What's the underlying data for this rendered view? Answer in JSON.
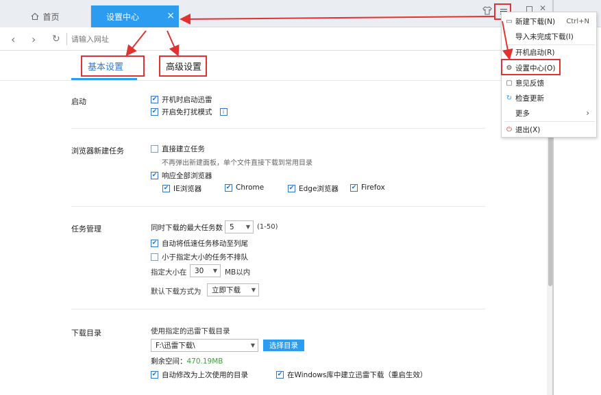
{
  "tabs": {
    "home": "首页",
    "settings": "设置中心",
    "close": "×"
  },
  "address": {
    "placeholder": "请输入网址"
  },
  "subtabs": {
    "basic": "基本设置",
    "advanced": "高级设置"
  },
  "startup": {
    "label": "启动",
    "boot_start": "开机时启动迅雷",
    "dnd_mode": "开启免打扰模式",
    "info": "i"
  },
  "browser_task": {
    "label": "浏览器新建任务",
    "direct_create": "直接建立任务",
    "direct_hint": "不再弹出新建面板，单个文件直接下载到常用目录",
    "respond_all": "响应全部浏览器",
    "browsers": [
      "IE浏览器",
      "Chrome",
      "Edge浏览器",
      "Firefox"
    ]
  },
  "task_mgmt": {
    "label": "任务管理",
    "max_tasks_label": "同时下载的最大任务数",
    "max_tasks_value": "5",
    "max_tasks_range": "(1-50)",
    "move_slow": "自动将低速任务移动至列尾",
    "small_no_queue": "小于指定大小的任务不排队",
    "size_label": "指定大小在",
    "size_value": "30",
    "size_unit": "MB以内",
    "default_mode_label": "默认下载方式为",
    "default_mode_value": "立即下载"
  },
  "download_dir": {
    "label": "下载目录",
    "use_specified": "使用指定的迅雷下载目录",
    "path": "F:\\迅雷下载\\",
    "browse": "选择目录",
    "free_label": "剩余空间：",
    "free_value": "470.19MB",
    "auto_change": "自动修改为上次使用的目录",
    "win_lib": "在Windows库中建立迅雷下载（重启生效）"
  },
  "menu": {
    "new_download": "新建下载(N)",
    "new_download_shortcut": "Ctrl+N",
    "import_unfinished": "导入未完成下载(I)",
    "boot_start": "开机启动(R)",
    "settings_center": "设置中心(O)",
    "feedback": "意见反馈",
    "check_update": "检查更新",
    "more": "更多",
    "exit": "退出(X)"
  },
  "colors": {
    "accent": "#2c9cf0",
    "highlight_box": "#e23131",
    "free_space": "#3aa53a"
  }
}
